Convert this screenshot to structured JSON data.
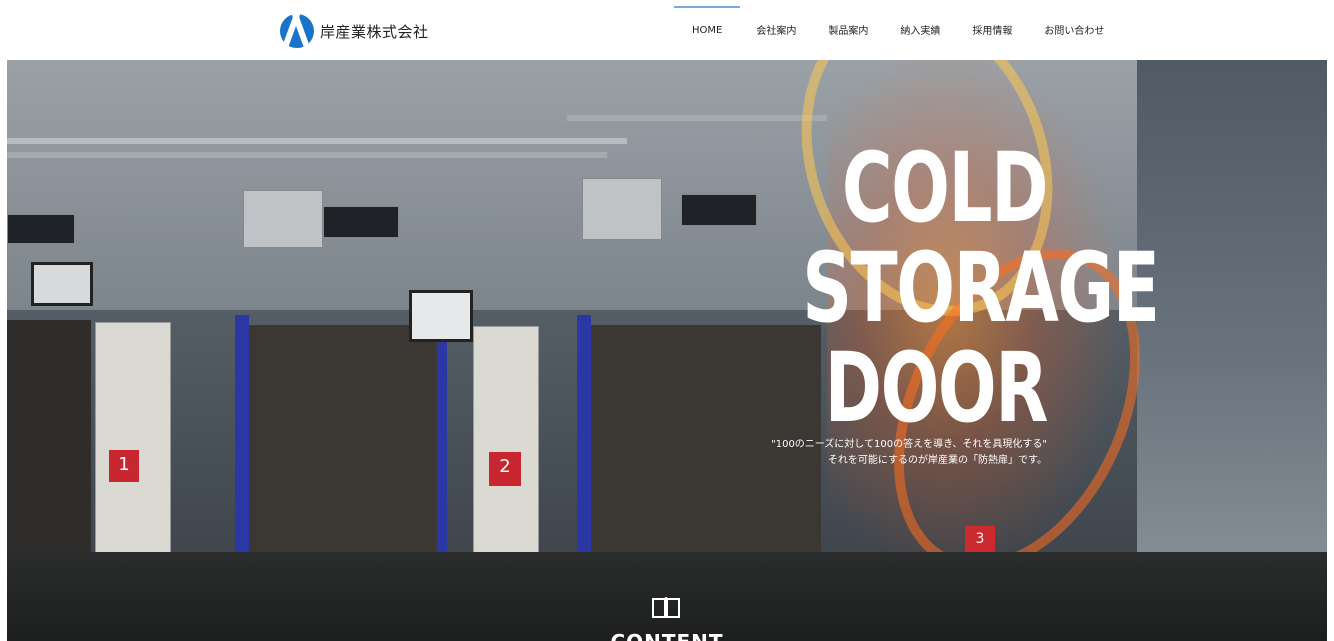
{
  "header": {
    "logo_text": "岸産業株式会社",
    "nav": [
      {
        "label": "HOME"
      },
      {
        "label": "会社案内"
      },
      {
        "label": "製品案内"
      },
      {
        "label": "納入実績"
      },
      {
        "label": "採用情報"
      },
      {
        "label": "お問い合わせ"
      }
    ]
  },
  "hero": {
    "title_line1": "COLD",
    "title_line2": "STORAGE",
    "title_line3": "DOOR",
    "subtitle_line1": "\"100のニーズに対して100の答えを導き、それを具現化する\"",
    "subtitle_line2": "それを可能にするのが岸産業の「防熱扉」です。",
    "door_numbers": [
      "1",
      "2",
      "3"
    ]
  },
  "content": {
    "label": "CONTENT",
    "icon": "book-icon"
  },
  "colors": {
    "accent": "#7aa8d8",
    "logo_blue": "#1a73c9"
  }
}
